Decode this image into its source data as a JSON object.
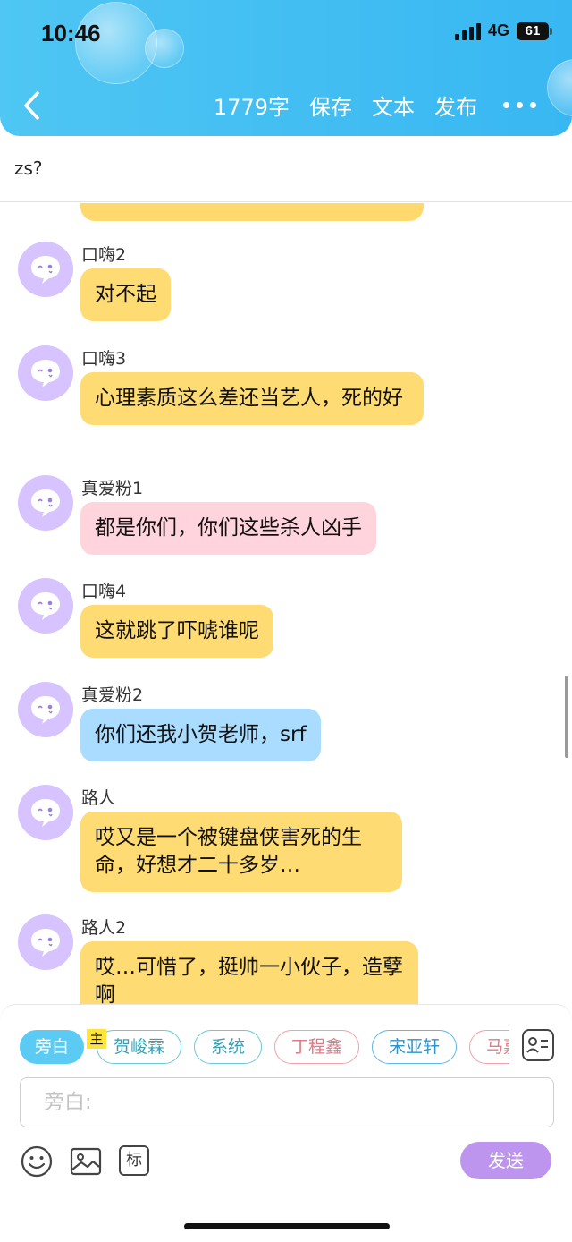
{
  "status": {
    "time": "10:46",
    "network": "4G",
    "battery": "61"
  },
  "nav": {
    "word_count": "1779字",
    "save": "保存",
    "text": "文本",
    "publish": "发布"
  },
  "title": "zs?",
  "messages": [
    {
      "sender": "口嗨2",
      "text": "对不起",
      "color": "yellow"
    },
    {
      "sender": "口嗨3",
      "text": "心理素质这么差还当艺人，死的好",
      "color": "yellow"
    },
    {
      "sender": "真爱粉1",
      "text": "都是你们，你们这些杀人凶手",
      "color": "pink"
    },
    {
      "sender": "口嗨4",
      "text": "这就跳了吓唬谁呢",
      "color": "yellow"
    },
    {
      "sender": "真爱粉2",
      "text": "你们还我小贺老师，srf",
      "color": "blue"
    },
    {
      "sender": "路人",
      "text": "哎又是一个被键盘侠害死的生命，好想才二十多岁…",
      "color": "yellow"
    },
    {
      "sender": "路人2",
      "text": "哎…可惜了，挺帅一小伙子，造孽啊",
      "color": "yellow"
    }
  ],
  "composer": {
    "chips": [
      "旁白",
      "贺峻霖",
      "系统",
      "丁程鑫",
      "宋亚轩",
      "马嘉祺"
    ],
    "host_badge": "主",
    "placeholder": "旁白:",
    "send": "发送",
    "mark": "标"
  },
  "colors": {
    "header": "#3db9f2",
    "bubble_yellow": "#ffdb73",
    "bubble_pink": "#ffd4dc",
    "bubble_blue": "#a9dcff",
    "avatar": "#d6c3ff",
    "send_button": "#bd95ef"
  },
  "icons": [
    "back-icon",
    "more-icon",
    "avatar-icon",
    "contact-card-icon",
    "emoji-icon",
    "image-icon",
    "mark-icon"
  ]
}
